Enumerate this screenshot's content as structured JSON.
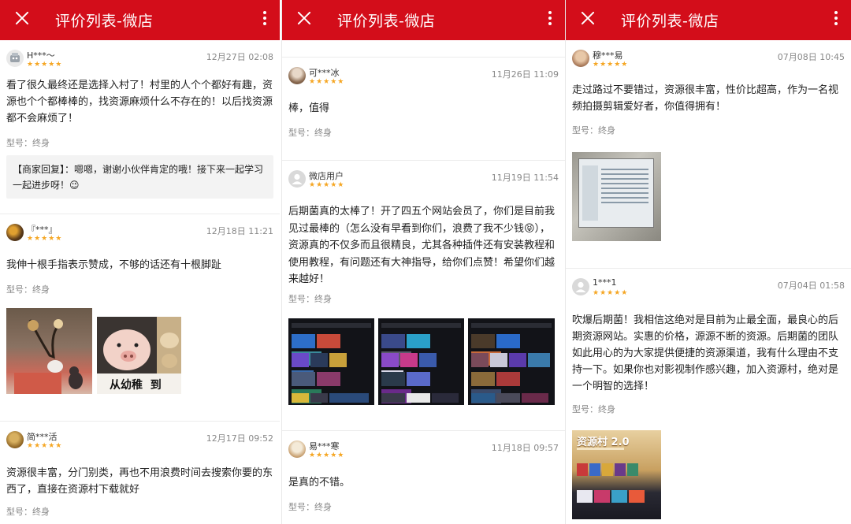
{
  "header": {
    "title": "评价列表-微店"
  },
  "reviews": [
    {
      "name": "H***～",
      "stars": "★★★★★",
      "time": "12月27日 02:08",
      "text": "看了很久最终还是选择入村了！村里的人个个都好有趣，资源也个个都棒棒的，找资源麻烦什么不存在的！以后找资源都不会麻烦了！",
      "model": "型号：终身",
      "reply": "【商家回复】：嗯嗯，谢谢小伙伴肯定的哦！接下来一起学习一起进步呀！😉"
    },
    {
      "name": "『***』",
      "stars": "★★★★★",
      "time": "12月18日 11:21",
      "text": "我伸十根手指表示赞成，不够的话还有十根脚趾",
      "model": "型号：终身",
      "img_caption": "从幼稚  到"
    },
    {
      "name": "简***活",
      "stars": "★★★★★",
      "time": "12月17日 09:52",
      "text": "资源很丰富，分门别类，再也不用浪费时间去搜索你要的东西了，直接在资源村下载就好",
      "model": "型号：终身"
    },
    {
      "name": "可***冰",
      "stars": "★★★★★",
      "time": "11月26日 11:09",
      "text": "棒，值得",
      "model": "型号：终身"
    },
    {
      "name": "微店用户",
      "stars": "★★★★★",
      "time": "11月19日 11:54",
      "text": "后期菌真的太棒了！开了四五个网站会员了，你们是目前我见过最棒的（怎么没有早看到你们，浪费了我不少钱😝），资源真的不仅多而且很精良，尤其各种插件还有安装教程和使用教程，有问题还有大神指导，给你们点赞！希望你们越来越好！",
      "model": "型号：终身"
    },
    {
      "name": "易***寒",
      "stars": "★★★★★",
      "time": "11月18日 09:57",
      "text": "是真的不错。",
      "model": "型号：终身"
    },
    {
      "name": "穆***易",
      "stars": "★★★★★",
      "time": "07月08日 10:45",
      "text": "走过路过不要错过，资源很丰富，性价比超高，作为一名视频拍摄剪辑爱好者，你值得拥有！",
      "model": "型号：终身"
    },
    {
      "name": "1***1",
      "stars": "★★★★★",
      "time": "07月04日 01:58",
      "text": "吹爆后期菌！我相信这绝对是目前为止最全面，最良心的后期资源网站。实惠的价格，源源不断的资源。后期菌的团队如此用心的为大家提供便捷的资源渠道，我有什么理由不支持一下。如果你也对影视制作感兴趣，加入资源村，绝对是一个明智的选择！",
      "model": "型号：终身",
      "img_caption": "资源村 2.0"
    }
  ]
}
